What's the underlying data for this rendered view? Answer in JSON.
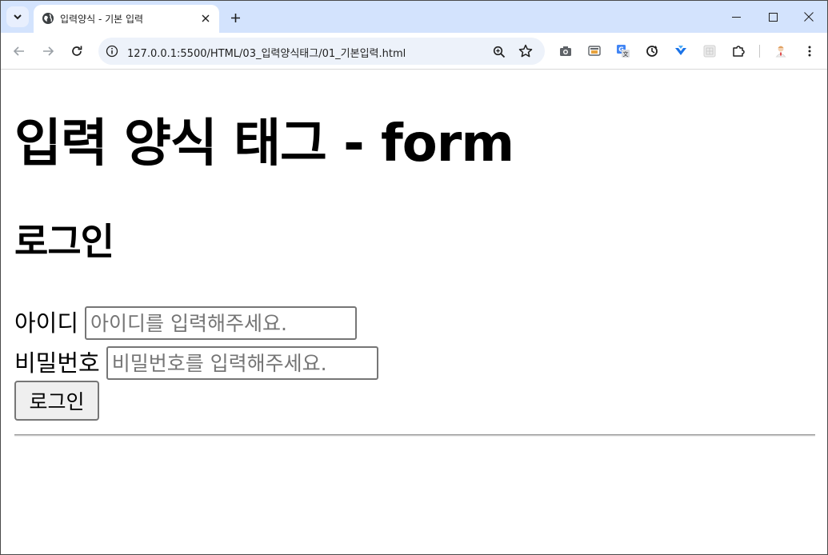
{
  "browser": {
    "tab_title": "입력양식 - 기본 입력",
    "url": "127.0.0.1:5500/HTML/03_입력양식태그/01_기본입력.html",
    "icons": {
      "tab_search": "chevron-down-icon",
      "favicon": "globe-icon",
      "tab_close": "close-icon",
      "new_tab": "plus-icon",
      "minimize": "minimize-icon",
      "maximize": "maximize-icon",
      "close_window": "close-icon",
      "back": "arrow-left-icon",
      "forward": "arrow-right-icon",
      "reload": "reload-icon",
      "site_info": "info-icon",
      "zoom": "zoom-icon",
      "bookmark": "star-icon",
      "extensions": [
        "camera-icon",
        "cast-icon",
        "translate-icon",
        "sync-icon",
        "download-arrow-icon",
        "grid-icon",
        "puzzle-icon"
      ],
      "profile": "avatar-icon",
      "menu": "kebab-menu-icon"
    }
  },
  "page": {
    "title": "입력 양식 태그 - form",
    "section_title": "로그인",
    "form": {
      "id_label": "아이디",
      "id_placeholder": "아이디를 입력해주세요.",
      "password_label": "비밀번호",
      "password_placeholder": "비밀번호를 입력해주세요.",
      "submit_label": "로그인"
    }
  },
  "colors": {
    "tabstrip": "#d3e3fd",
    "omnibox": "#edf2fa",
    "button_bg": "#efefef",
    "field_border": "#767676"
  }
}
